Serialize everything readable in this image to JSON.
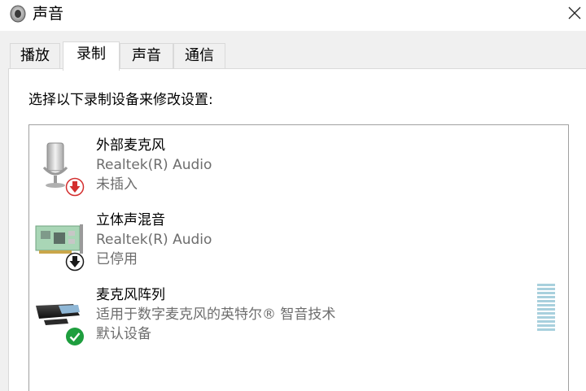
{
  "window": {
    "title": "声音",
    "icon": "speaker-icon",
    "close_icon": "close-icon"
  },
  "tabs": [
    {
      "label": "播放",
      "active": false
    },
    {
      "label": "录制",
      "active": true
    },
    {
      "label": "声音",
      "active": false
    },
    {
      "label": "通信",
      "active": false
    }
  ],
  "recording": {
    "instruction": "选择以下录制设备来修改设置:",
    "devices": [
      {
        "name": "外部麦克风",
        "description": "Realtek(R) Audio",
        "status": "未插入",
        "icon": "microphone-icon",
        "badge": "unplugged-red-arrow-icon"
      },
      {
        "name": "立体声混音",
        "description": "Realtek(R) Audio",
        "status": "已停用",
        "icon": "sound-card-icon",
        "badge": "disabled-black-arrow-icon"
      },
      {
        "name": "麦克风阵列",
        "description": "适用于数字麦克风的英特尔® 智音技术",
        "status": "默认设备",
        "icon": "microphone-array-icon",
        "badge": "default-check-icon"
      }
    ],
    "level_meter_bars": 12
  },
  "colors": {
    "badge_red": "#d32f2f",
    "badge_black": "#1a1a1a",
    "badge_green": "#1e9e3e",
    "meter": "#a8d0dd"
  }
}
